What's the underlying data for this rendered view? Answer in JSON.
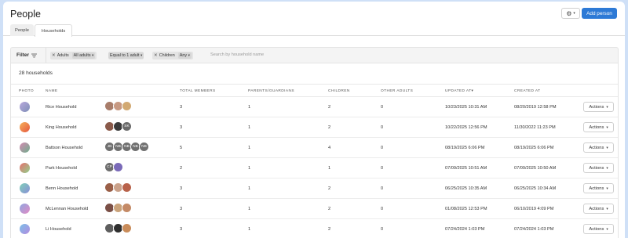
{
  "header": {
    "title": "People",
    "add_button": "Add person"
  },
  "tabs": [
    {
      "label": "People",
      "active": false
    },
    {
      "label": "Households",
      "active": true
    }
  ],
  "filters": {
    "label": "Filter",
    "chips": [
      {
        "field": "Adults",
        "value": "All adults"
      },
      {
        "field": "",
        "value": "Equal to 1 adult"
      },
      {
        "field": "Children",
        "value": "Any"
      }
    ],
    "search_placeholder": "Search by household name"
  },
  "summary": {
    "count": "28 households"
  },
  "columns": [
    "PHOTO",
    "NAME",
    "TOTAL MEMBERS",
    "PARENTS/GUARDIANS",
    "CHILDREN",
    "OTHER ADULTS",
    "UPDATED AT",
    "CREATED AT"
  ],
  "households": [
    {
      "name": "Rice Household",
      "total": "3",
      "parents": "1",
      "children": "2",
      "other": "0",
      "updated": "10/23/2025 10:31 AM",
      "created": "08/20/2019 12:58 PM",
      "photo": [
        "#b9a9dc",
        "#7f8fb8"
      ],
      "avatars": [
        {
          "t": "",
          "c": "#a87d6a"
        },
        {
          "t": "",
          "c": "#c79982"
        },
        {
          "t": "",
          "c": "#d2a972"
        }
      ]
    },
    {
      "name": "King Household",
      "total": "3",
      "parents": "1",
      "children": "2",
      "other": "0",
      "updated": "10/22/2025 12:56 PM",
      "created": "11/30/2022 11:23 PM",
      "photo": [
        "#f6b25a",
        "#e5573f"
      ],
      "avatars": [
        {
          "t": "",
          "c": "#8a5a4a"
        },
        {
          "t": "",
          "c": "#3a3a3a"
        },
        {
          "t": "SK",
          "c": "#6a6a6a"
        }
      ]
    },
    {
      "name": "Battson Household",
      "total": "5",
      "parents": "1",
      "children": "4",
      "other": "0",
      "updated": "08/19/2025 6:06 PM",
      "created": "08/19/2025 6:06 PM",
      "photo": [
        "#d58ab2",
        "#6fae8c"
      ],
      "avatars": [
        {
          "t": "JB",
          "c": "#707070"
        },
        {
          "t": "NB",
          "c": "#707070"
        },
        {
          "t": "NB",
          "c": "#707070"
        },
        {
          "t": "NB",
          "c": "#707070"
        },
        {
          "t": "NB",
          "c": "#707070"
        }
      ]
    },
    {
      "name": "Park Household",
      "total": "2",
      "parents": "1",
      "children": "1",
      "other": "0",
      "updated": "07/09/2025 10:51 AM",
      "created": "07/09/2025 10:50 AM",
      "photo": [
        "#e86f6f",
        "#8fd18a"
      ],
      "avatars": [
        {
          "t": "CP",
          "c": "#6e6e6e"
        },
        {
          "t": "",
          "c": "#7a6ab8"
        }
      ]
    },
    {
      "name": "Benn Household",
      "total": "3",
      "parents": "1",
      "children": "2",
      "other": "0",
      "updated": "06/25/2025 10:35 AM",
      "created": "06/25/2025 10:34 AM",
      "photo": [
        "#7fd0b8",
        "#8a8fd8"
      ],
      "avatars": [
        {
          "t": "",
          "c": "#9a5f48"
        },
        {
          "t": "",
          "c": "#caa18a"
        },
        {
          "t": "",
          "c": "#b8624a"
        }
      ]
    },
    {
      "name": "McLennan Household",
      "total": "3",
      "parents": "1",
      "children": "2",
      "other": "0",
      "updated": "01/08/2025 12:53 PM",
      "created": "06/10/2019 4:09 PM",
      "photo": [
        "#8fa6e0",
        "#e38bc4"
      ],
      "avatars": [
        {
          "t": "",
          "c": "#7a4f46"
        },
        {
          "t": "",
          "c": "#c9a27a"
        },
        {
          "t": "",
          "c": "#c48a66"
        }
      ]
    },
    {
      "name": "Li Household",
      "total": "3",
      "parents": "1",
      "children": "2",
      "other": "0",
      "updated": "07/24/2024 1:03 PM",
      "created": "07/24/2024 1:03 PM",
      "photo": [
        "#7ac0e8",
        "#b48be0"
      ],
      "avatars": [
        {
          "t": "",
          "c": "#5e5e5e"
        },
        {
          "t": "",
          "c": "#2e2e2e"
        },
        {
          "t": "",
          "c": "#c98c5a"
        }
      ]
    }
  ],
  "row_action_label": "Actions"
}
